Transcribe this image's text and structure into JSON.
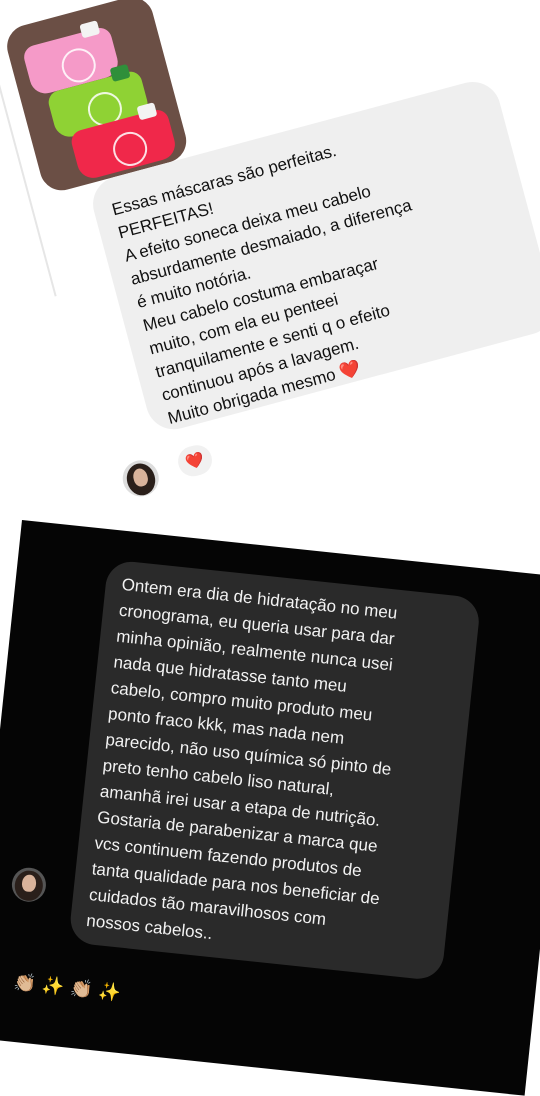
{
  "light_chat": {
    "product_image_alt": "Três frascos de máscara capilar (rosa, verde, vermelho)",
    "message_lines": [
      "Essas máscaras são perfeitas.",
      "PERFEITAS!",
      "A efeito soneca deixa meu cabelo",
      "absurdamente desmaiado, a diferença",
      "é muito notória.",
      "Meu cabelo costuma embaraçar",
      "muito, com ela eu penteei",
      "tranquilamente e senti q o efeito",
      "continuou após a lavagem.",
      "Muito obrigada mesmo ❤️"
    ],
    "reaction": "❤️"
  },
  "dark_chat": {
    "message_lines": [
      "Ontem era dia de hidratação no meu",
      "cronograma, eu queria usar para dar",
      "minha opinião, realmente nunca usei",
      "nada que hidratasse tanto meu",
      "cabelo, compro muito produto meu",
      "ponto fraco kkk, mas nada nem",
      "parecido, não uso química só pinto de",
      "preto tenho cabelo liso natural,",
      "amanhã irei usar a etapa de nutrição.",
      "Gostaria de parabenizar a marca que",
      "vcs continuem fazendo produtos de",
      "tanta qualidade para nos beneficiar de",
      "cuidados tão maravilhosos com",
      "nossos cabelos.."
    ],
    "emoji_strip": "👏🏼✨👏🏼✨"
  },
  "colors": {
    "light_bubble": "#efefef",
    "dark_bubble": "#2a2a2a",
    "dark_background": "#050505",
    "bottle_pink": "#f59ac8",
    "bottle_green": "#8fd234",
    "bottle_red": "#f0284a"
  }
}
